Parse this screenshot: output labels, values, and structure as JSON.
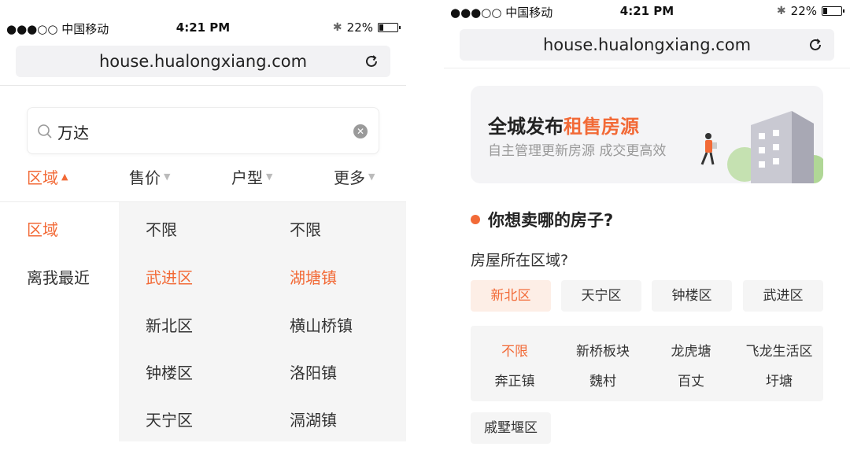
{
  "colors": {
    "accent": "#f26a37",
    "panel_bg": "#f5f5f5"
  },
  "left": {
    "status": {
      "carrier": "●●●○○ 中国移动",
      "time": "4:21 PM",
      "battery": "22%",
      "battery_level": 0.22
    },
    "url": "house.hualongxiang.com",
    "search": {
      "value": "万达",
      "icon": "search-icon",
      "clear_icon": "clear-icon"
    },
    "filters": [
      {
        "label": "区域",
        "active": true
      },
      {
        "label": "售价",
        "active": false
      },
      {
        "label": "户型",
        "active": false
      },
      {
        "label": "更多",
        "active": false
      }
    ],
    "level1": [
      {
        "label": "区域",
        "active": true
      },
      {
        "label": "离我最近",
        "active": false
      }
    ],
    "level2": [
      {
        "label": "不限",
        "active": false
      },
      {
        "label": "武进区",
        "active": true
      },
      {
        "label": "新北区",
        "active": false
      },
      {
        "label": "钟楼区",
        "active": false
      },
      {
        "label": "天宁区",
        "active": false
      }
    ],
    "level3": [
      {
        "label": "不限",
        "active": false
      },
      {
        "label": "湖塘镇",
        "active": true
      },
      {
        "label": "横山桥镇",
        "active": false
      },
      {
        "label": "洛阳镇",
        "active": false
      },
      {
        "label": "滆湖镇",
        "active": false
      }
    ]
  },
  "right": {
    "status": {
      "carrier": "●●●○○ 中国移动",
      "time": "4:21 PM",
      "battery": "22%",
      "battery_level": 0.22
    },
    "url": "house.hualongxiang.com",
    "banner": {
      "title_plain": "全城发布",
      "title_highlight": "租售房源",
      "subtitle": "自主管理更新房源  成交更高效"
    },
    "section_title": "你想卖哪的房子?",
    "question": "房屋所在区域?",
    "districts": [
      {
        "label": "新北区",
        "active": true
      },
      {
        "label": "天宁区",
        "active": false
      },
      {
        "label": "钟楼区",
        "active": false
      },
      {
        "label": "武进区",
        "active": false
      }
    ],
    "sub_areas": [
      {
        "label": "不限",
        "active": true
      },
      {
        "label": "新桥板块",
        "active": false
      },
      {
        "label": "龙虎塘",
        "active": false
      },
      {
        "label": "飞龙生活区",
        "active": false
      },
      {
        "label": "奔正镇",
        "active": false
      },
      {
        "label": "魏村",
        "active": false
      },
      {
        "label": "百丈",
        "active": false
      },
      {
        "label": "圩塘",
        "active": false
      }
    ],
    "extra_chip": "戚墅堰区"
  }
}
